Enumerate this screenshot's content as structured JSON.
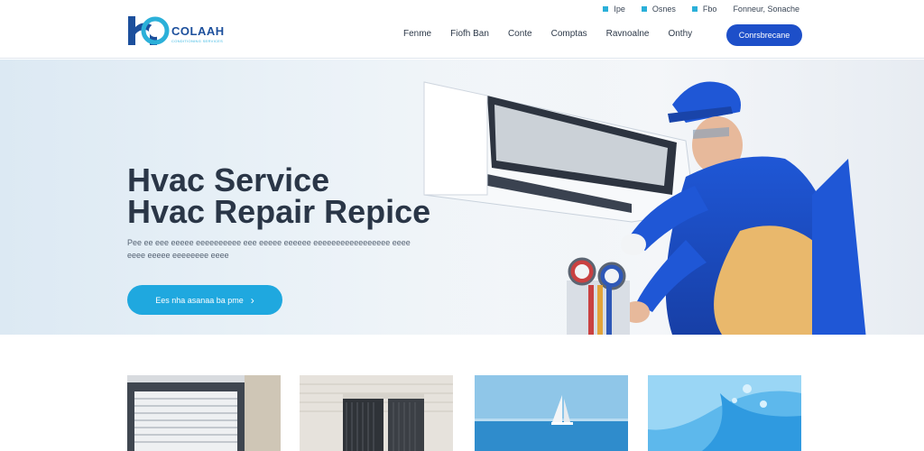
{
  "header": {
    "logo": {
      "name": "COLAAH",
      "tagline": "CONDITIONING SERVICES"
    },
    "utility": [
      {
        "label": "Ipe"
      },
      {
        "label": "Osnes"
      },
      {
        "label": "Fbo"
      },
      {
        "label": "Fonneur, Sonache"
      }
    ],
    "nav": [
      {
        "label": "Fenme"
      },
      {
        "label": "Fiofh Ban"
      },
      {
        "label": "Conte"
      },
      {
        "label": "Comptas"
      },
      {
        "label": "Ravnoalne"
      },
      {
        "label": "Onthy"
      }
    ],
    "cta_label": "Conrsbrecane"
  },
  "hero": {
    "title": "Hvac Service",
    "subtitle": "Hvac Repair Repice",
    "description": "Pee ee eee eeeee eeeeeeeeee eee eeeee eeeeee eeeeeeeeeeeeeeeee eeee eeee eeeee eeeeeeee eeee",
    "button_label": "Ees nha asanaa ba pme",
    "button_icon": "chevron-right-icon"
  },
  "cards": [
    {
      "icon": "window-shutter-image"
    },
    {
      "icon": "hvac-unit-image"
    },
    {
      "icon": "sailboat-image"
    },
    {
      "icon": "water-splash-image"
    }
  ],
  "colors": {
    "brand": "#1d4fc9",
    "accent": "#1fa8df",
    "text": "#2a3647"
  }
}
